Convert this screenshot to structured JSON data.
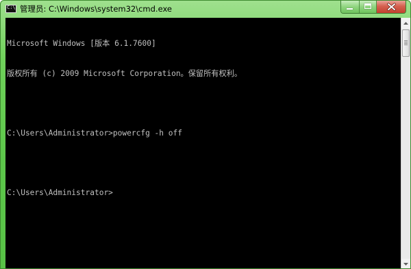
{
  "window": {
    "title": "管理员: C:\\Windows\\system32\\cmd.exe",
    "app_icon": "cmd-icon",
    "buttons": {
      "minimize_icon": "minimize-icon",
      "maximize_icon": "maximize-icon",
      "close_icon": "close-icon"
    }
  },
  "console": {
    "lines": [
      "Microsoft Windows [版本 6.1.7600]",
      "版权所有 (c) 2009 Microsoft Corporation。保留所有权利。",
      "",
      "C:\\Users\\Administrator>powercfg -h off",
      "",
      "C:\\Users\\Administrator>"
    ]
  },
  "colors": {
    "titlebar": "#6fd15a",
    "console_background": "#000000",
    "console_text": "#c0c0c0",
    "close_button": "#c9493a"
  }
}
